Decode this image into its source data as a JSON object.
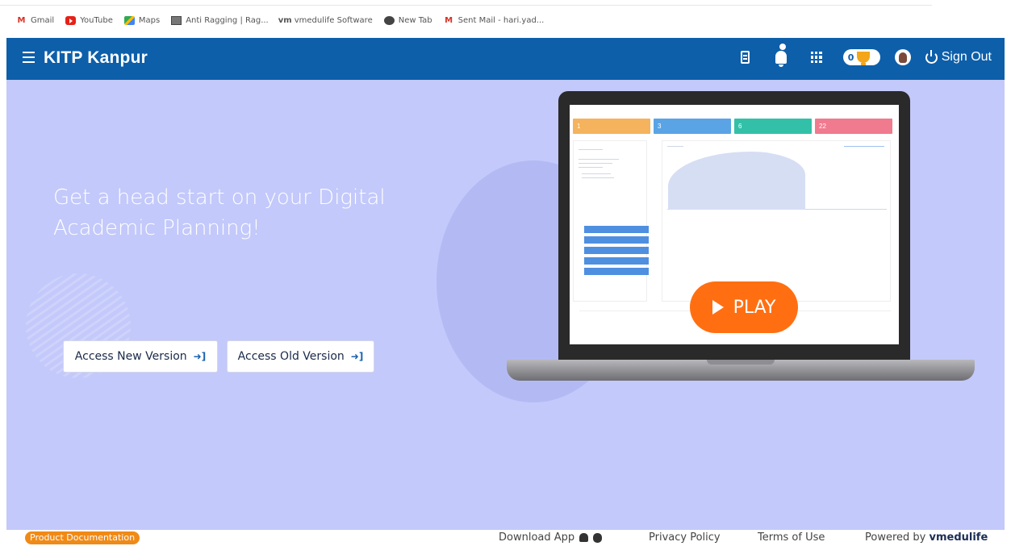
{
  "bookmarks": [
    {
      "label": "Gmail",
      "icon": "gmail-icon"
    },
    {
      "label": "YouTube",
      "icon": "youtube-icon"
    },
    {
      "label": "Maps",
      "icon": "maps-icon"
    },
    {
      "label": "Anti Ragging | Rag...",
      "icon": "anti-ragging-icon"
    },
    {
      "label": "vmedulife Software",
      "icon": "vmedulife-icon"
    },
    {
      "label": "New Tab",
      "icon": "globe-icon"
    },
    {
      "label": "Sent Mail - hari.yad...",
      "icon": "gmail-icon"
    }
  ],
  "header": {
    "title": "KITP Kanpur",
    "trophy_count": "0",
    "sign_out": "Sign Out",
    "bg_color": "#0d5faa"
  },
  "hero": {
    "headline": "Get a head start on your Digital Academic Planning!",
    "new_version_label": "Access New Version",
    "old_version_label": "Access Old Version",
    "play_label": "PLAY",
    "bg_color": "#c3c9fa"
  },
  "footer": {
    "product_doc": "Product Documentation",
    "download_app": "Download App",
    "privacy": "Privacy Policy",
    "terms": "Terms of Use",
    "powered_prefix": "Powered by",
    "powered_brand": "vmedulife"
  }
}
